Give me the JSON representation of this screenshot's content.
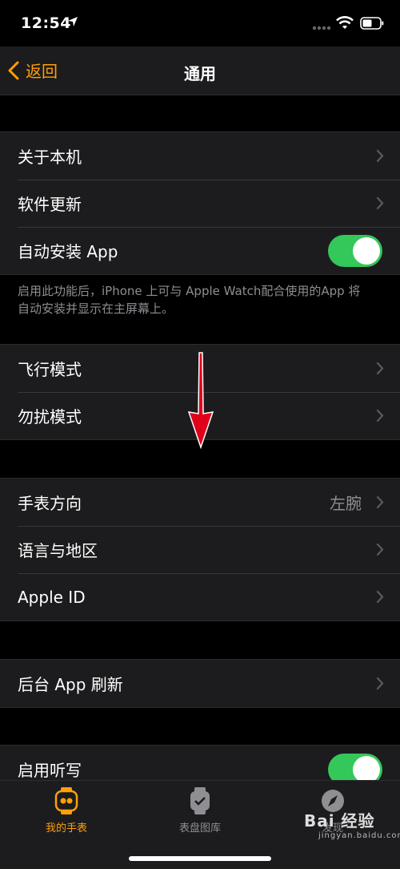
{
  "status_bar": {
    "time": "12:54"
  },
  "nav": {
    "back_label": "返回",
    "title": "通用"
  },
  "group1": {
    "items": [
      {
        "label": "关于本机"
      },
      {
        "label": "软件更新"
      },
      {
        "label": "自动安装 App",
        "toggle_on": true
      }
    ],
    "footer": "启用此功能后，iPhone 上可与 Apple Watch配合使用的App 将自动安装并显示在主屏幕上。"
  },
  "group2": {
    "items": [
      {
        "label": "飞行模式"
      },
      {
        "label": "勿扰模式"
      }
    ]
  },
  "group3": {
    "items": [
      {
        "label": "手表方向",
        "value": "左腕"
      },
      {
        "label": "语言与地区"
      },
      {
        "label": "Apple ID"
      }
    ]
  },
  "group4": {
    "items": [
      {
        "label": "后台 App 刷新"
      }
    ]
  },
  "group5": {
    "items": [
      {
        "label": "启用听写",
        "toggle_on": true
      }
    ]
  },
  "tabbar": {
    "tabs": [
      {
        "label": "我的手表",
        "active": true,
        "icon": "watch-icon"
      },
      {
        "label": "表盘图库",
        "active": false,
        "icon": "watch-face-icon"
      },
      {
        "label": "发现",
        "active": false,
        "icon": "compass-icon"
      }
    ]
  },
  "watermark": {
    "text": "Bai 经验",
    "sub": "jingyan.baidu.com"
  },
  "colors": {
    "accent": "#ff9f0a",
    "toggle_on": "#34c759",
    "background": "#000000",
    "cell": "#1c1c1e",
    "annotation_arrow": "#e0001a"
  }
}
